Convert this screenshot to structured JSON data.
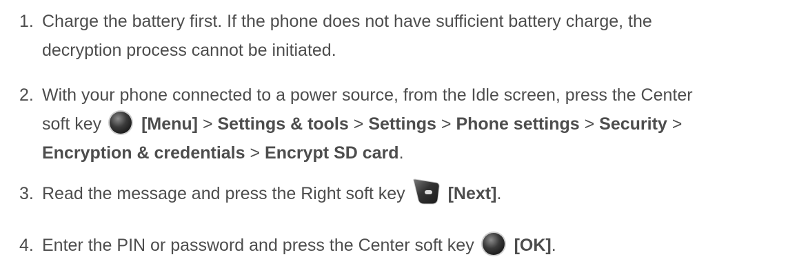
{
  "icons": {
    "center_key": "center-soft-key-icon",
    "right_key": "right-soft-key-icon"
  },
  "colors": {
    "text": "#4d4d4d",
    "key_dark": "#2a2a2a",
    "key_light": "#8c8c8c"
  },
  "steps": [
    {
      "number": "1.",
      "line1": "Charge the battery first. If the phone does not have sufficient battery charge, the",
      "line2": "decryption process cannot be initiated."
    },
    {
      "number": "2.",
      "intro": "With your phone connected to a power source, from the Idle screen, press the Center",
      "soft_key": "soft key",
      "menu": "[Menu]",
      "sep": ">",
      "path1": "Settings & tools",
      "path2": "Settings",
      "path3": "Phone settings",
      "path4": "Security",
      "path5": "Encryption & credentials",
      "path6": "Encrypt SD card",
      "end": "."
    },
    {
      "number": "3.",
      "text": "Read the message and press the Right soft key",
      "action": "[Next]",
      "end": "."
    },
    {
      "number": "4.",
      "text": "Enter the PIN or password and press the Center soft key",
      "action": "[OK]",
      "end": "."
    }
  ]
}
